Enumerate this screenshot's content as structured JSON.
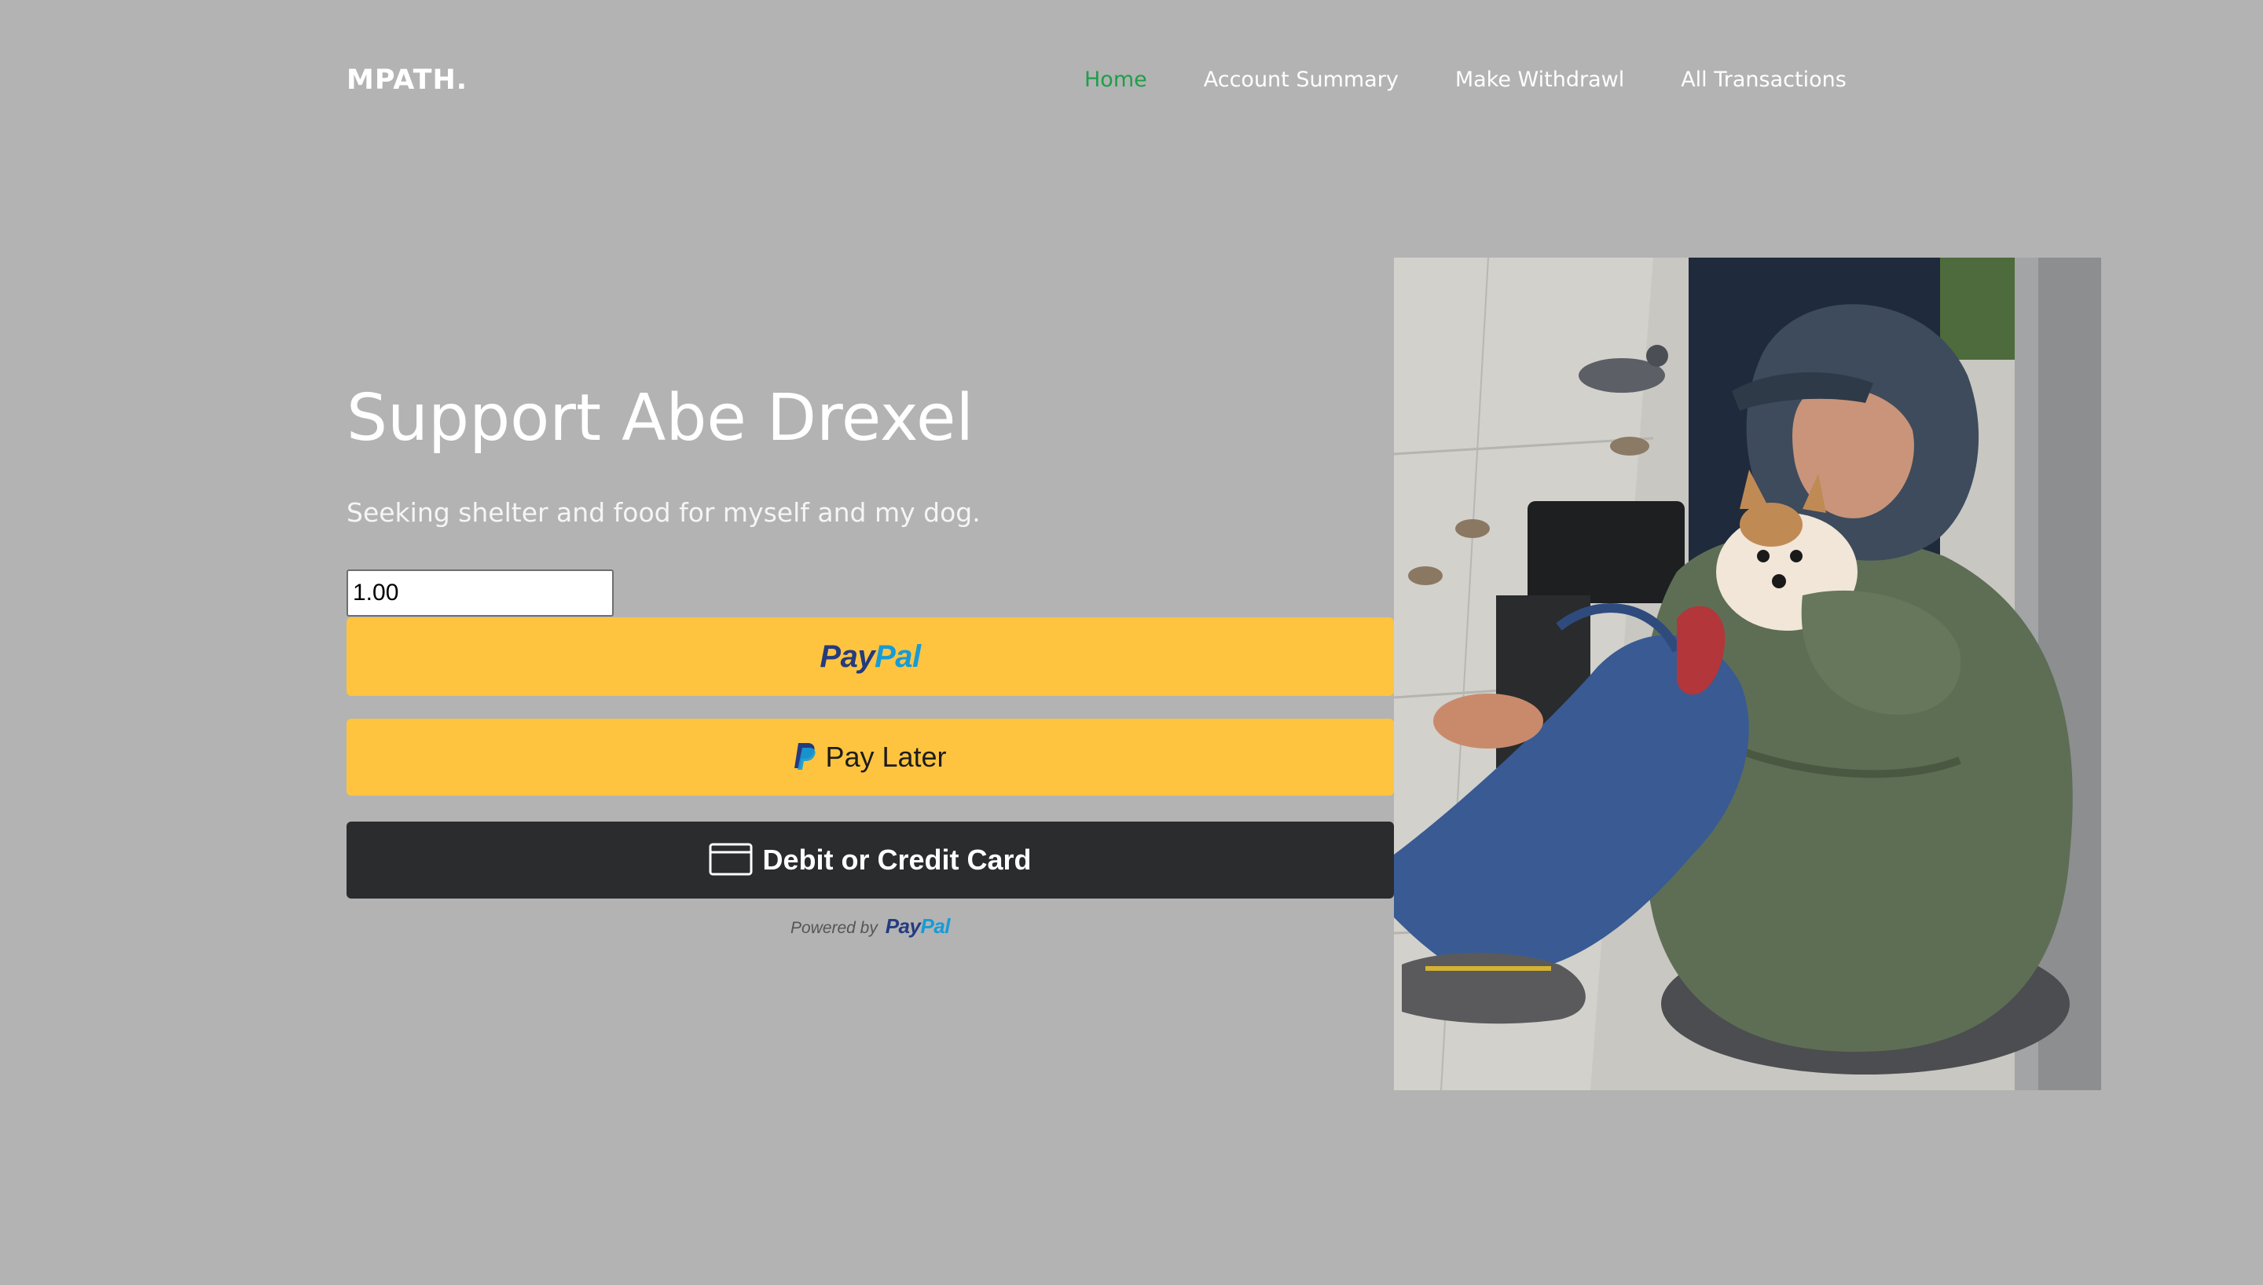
{
  "brand": {
    "logo": "MPATH."
  },
  "nav": {
    "items": [
      {
        "label": "Home"
      },
      {
        "label": "Account Summary"
      },
      {
        "label": "Make Withdrawl"
      },
      {
        "label": "All Transactions"
      }
    ],
    "active_color": "#1e9e4a"
  },
  "campaign": {
    "title": "Support Abe Drexel",
    "description": "Seeking shelter and food for myself and my dog.",
    "amount_value": "1.00"
  },
  "payment": {
    "paypal_label_part1": "Pay",
    "paypal_label_part2": "Pal",
    "paylater_label": "Pay Later",
    "card_label": "Debit or Credit Card",
    "powered_by": "Powered by",
    "button_color": "#ffc43f",
    "card_button_color": "#2b2c2e"
  },
  "colors": {
    "background": "#b3b3b3",
    "paypal_dark_blue": "#253b80",
    "paypal_light_blue": "#179bd7"
  }
}
